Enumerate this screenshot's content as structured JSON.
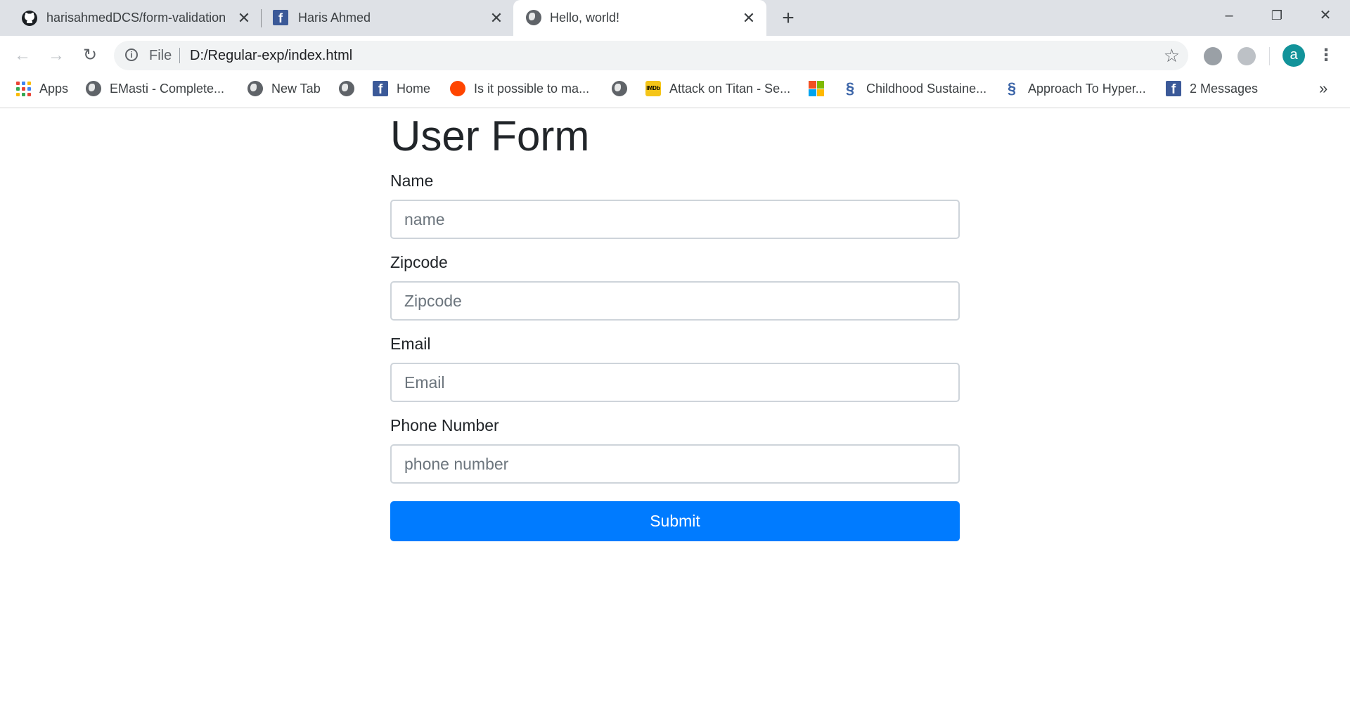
{
  "browser": {
    "tabs": [
      {
        "title": "harisahmedDCS/form-validation",
        "icon": "github-icon",
        "active": false
      },
      {
        "title": "Haris Ahmed",
        "icon": "facebook-icon",
        "active": false
      },
      {
        "title": "Hello, world!",
        "icon": "globe-icon",
        "active": true
      }
    ],
    "new_tab_icon": "plus-icon",
    "window_controls": {
      "minimize": "–",
      "restore": "❐",
      "close": "✕"
    },
    "toolbar": {
      "back_icon": "back-arrow-icon",
      "forward_icon": "forward-arrow-icon",
      "reload_icon": "reload-icon",
      "scheme_label": "File",
      "url": "D:/Regular-exp/index.html",
      "avatar_letter": "a"
    },
    "bookmarks": [
      {
        "label": "Apps",
        "icon": "apps-grid-icon"
      },
      {
        "label": "EMasti - Complete...",
        "icon": "globe-icon"
      },
      {
        "label": "New Tab",
        "icon": "globe-icon"
      },
      {
        "label": "",
        "icon": "globe-icon"
      },
      {
        "label": "Home",
        "icon": "facebook-icon"
      },
      {
        "label": "Is it possible to ma...",
        "icon": "reddit-icon"
      },
      {
        "label": "",
        "icon": "globe-icon"
      },
      {
        "label": "Attack on Titan - Se...",
        "icon": "imdb-icon"
      },
      {
        "label": "",
        "icon": "microsoft-icon"
      },
      {
        "label": "Childhood Sustaine...",
        "icon": "wave-icon"
      },
      {
        "label": "Approach To Hyper...",
        "icon": "wave-icon"
      },
      {
        "label": "2 Messages",
        "icon": "facebook-icon"
      }
    ],
    "bookmarks_overflow": "»"
  },
  "page": {
    "title": "User Form",
    "fields": [
      {
        "label": "Name",
        "placeholder": "name"
      },
      {
        "label": "Zipcode",
        "placeholder": "Zipcode"
      },
      {
        "label": "Email",
        "placeholder": "Email"
      },
      {
        "label": "Phone Number",
        "placeholder": "phone number"
      }
    ],
    "submit_label": "Submit",
    "accent_color": "#007bff"
  }
}
